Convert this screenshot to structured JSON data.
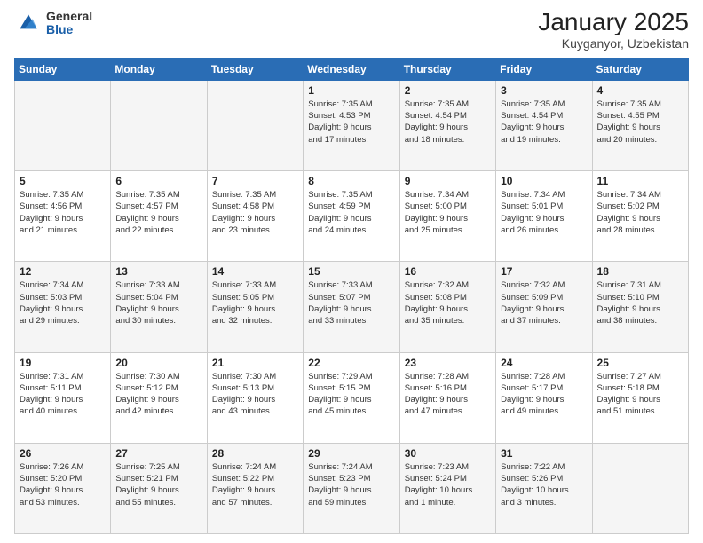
{
  "header": {
    "logo_general": "General",
    "logo_blue": "Blue",
    "title": "January 2025",
    "subtitle": "Kuyganyor, Uzbekistan"
  },
  "calendar": {
    "days_of_week": [
      "Sunday",
      "Monday",
      "Tuesday",
      "Wednesday",
      "Thursday",
      "Friday",
      "Saturday"
    ],
    "weeks": [
      [
        {
          "day": "",
          "info": ""
        },
        {
          "day": "",
          "info": ""
        },
        {
          "day": "",
          "info": ""
        },
        {
          "day": "1",
          "info": "Sunrise: 7:35 AM\nSunset: 4:53 PM\nDaylight: 9 hours\nand 17 minutes."
        },
        {
          "day": "2",
          "info": "Sunrise: 7:35 AM\nSunset: 4:54 PM\nDaylight: 9 hours\nand 18 minutes."
        },
        {
          "day": "3",
          "info": "Sunrise: 7:35 AM\nSunset: 4:54 PM\nDaylight: 9 hours\nand 19 minutes."
        },
        {
          "day": "4",
          "info": "Sunrise: 7:35 AM\nSunset: 4:55 PM\nDaylight: 9 hours\nand 20 minutes."
        }
      ],
      [
        {
          "day": "5",
          "info": "Sunrise: 7:35 AM\nSunset: 4:56 PM\nDaylight: 9 hours\nand 21 minutes."
        },
        {
          "day": "6",
          "info": "Sunrise: 7:35 AM\nSunset: 4:57 PM\nDaylight: 9 hours\nand 22 minutes."
        },
        {
          "day": "7",
          "info": "Sunrise: 7:35 AM\nSunset: 4:58 PM\nDaylight: 9 hours\nand 23 minutes."
        },
        {
          "day": "8",
          "info": "Sunrise: 7:35 AM\nSunset: 4:59 PM\nDaylight: 9 hours\nand 24 minutes."
        },
        {
          "day": "9",
          "info": "Sunrise: 7:34 AM\nSunset: 5:00 PM\nDaylight: 9 hours\nand 25 minutes."
        },
        {
          "day": "10",
          "info": "Sunrise: 7:34 AM\nSunset: 5:01 PM\nDaylight: 9 hours\nand 26 minutes."
        },
        {
          "day": "11",
          "info": "Sunrise: 7:34 AM\nSunset: 5:02 PM\nDaylight: 9 hours\nand 28 minutes."
        }
      ],
      [
        {
          "day": "12",
          "info": "Sunrise: 7:34 AM\nSunset: 5:03 PM\nDaylight: 9 hours\nand 29 minutes."
        },
        {
          "day": "13",
          "info": "Sunrise: 7:33 AM\nSunset: 5:04 PM\nDaylight: 9 hours\nand 30 minutes."
        },
        {
          "day": "14",
          "info": "Sunrise: 7:33 AM\nSunset: 5:05 PM\nDaylight: 9 hours\nand 32 minutes."
        },
        {
          "day": "15",
          "info": "Sunrise: 7:33 AM\nSunset: 5:07 PM\nDaylight: 9 hours\nand 33 minutes."
        },
        {
          "day": "16",
          "info": "Sunrise: 7:32 AM\nSunset: 5:08 PM\nDaylight: 9 hours\nand 35 minutes."
        },
        {
          "day": "17",
          "info": "Sunrise: 7:32 AM\nSunset: 5:09 PM\nDaylight: 9 hours\nand 37 minutes."
        },
        {
          "day": "18",
          "info": "Sunrise: 7:31 AM\nSunset: 5:10 PM\nDaylight: 9 hours\nand 38 minutes."
        }
      ],
      [
        {
          "day": "19",
          "info": "Sunrise: 7:31 AM\nSunset: 5:11 PM\nDaylight: 9 hours\nand 40 minutes."
        },
        {
          "day": "20",
          "info": "Sunrise: 7:30 AM\nSunset: 5:12 PM\nDaylight: 9 hours\nand 42 minutes."
        },
        {
          "day": "21",
          "info": "Sunrise: 7:30 AM\nSunset: 5:13 PM\nDaylight: 9 hours\nand 43 minutes."
        },
        {
          "day": "22",
          "info": "Sunrise: 7:29 AM\nSunset: 5:15 PM\nDaylight: 9 hours\nand 45 minutes."
        },
        {
          "day": "23",
          "info": "Sunrise: 7:28 AM\nSunset: 5:16 PM\nDaylight: 9 hours\nand 47 minutes."
        },
        {
          "day": "24",
          "info": "Sunrise: 7:28 AM\nSunset: 5:17 PM\nDaylight: 9 hours\nand 49 minutes."
        },
        {
          "day": "25",
          "info": "Sunrise: 7:27 AM\nSunset: 5:18 PM\nDaylight: 9 hours\nand 51 minutes."
        }
      ],
      [
        {
          "day": "26",
          "info": "Sunrise: 7:26 AM\nSunset: 5:20 PM\nDaylight: 9 hours\nand 53 minutes."
        },
        {
          "day": "27",
          "info": "Sunrise: 7:25 AM\nSunset: 5:21 PM\nDaylight: 9 hours\nand 55 minutes."
        },
        {
          "day": "28",
          "info": "Sunrise: 7:24 AM\nSunset: 5:22 PM\nDaylight: 9 hours\nand 57 minutes."
        },
        {
          "day": "29",
          "info": "Sunrise: 7:24 AM\nSunset: 5:23 PM\nDaylight: 9 hours\nand 59 minutes."
        },
        {
          "day": "30",
          "info": "Sunrise: 7:23 AM\nSunset: 5:24 PM\nDaylight: 10 hours\nand 1 minute."
        },
        {
          "day": "31",
          "info": "Sunrise: 7:22 AM\nSunset: 5:26 PM\nDaylight: 10 hours\nand 3 minutes."
        },
        {
          "day": "",
          "info": ""
        }
      ]
    ]
  }
}
